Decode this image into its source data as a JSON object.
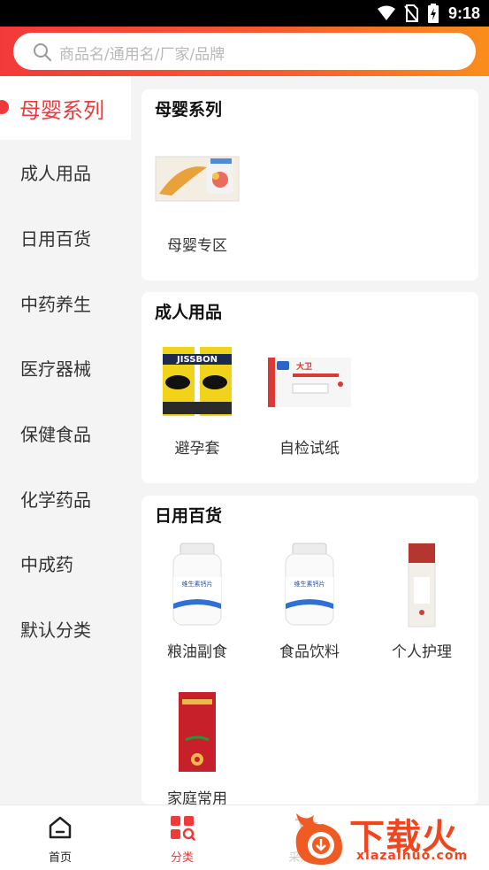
{
  "status_bar": {
    "time": "9:18"
  },
  "search": {
    "placeholder": "商品名/通用名/厂家/品牌"
  },
  "sidebar": {
    "items": [
      {
        "label": "母婴系列",
        "active": true
      },
      {
        "label": "成人用品"
      },
      {
        "label": "日用百货"
      },
      {
        "label": "中药养生"
      },
      {
        "label": "医疗器械"
      },
      {
        "label": "保健食品"
      },
      {
        "label": "化学药品"
      },
      {
        "label": "中成药"
      },
      {
        "label": "默认分类"
      }
    ]
  },
  "sections": [
    {
      "title": "母婴系列",
      "items": [
        {
          "name": "母婴专区"
        }
      ]
    },
    {
      "title": "成人用品",
      "items": [
        {
          "name": "避孕套"
        },
        {
          "name": "自检试纸"
        }
      ]
    },
    {
      "title": "日用百货",
      "items": [
        {
          "name": "粮油副食"
        },
        {
          "name": "食品饮料"
        },
        {
          "name": "个人护理"
        },
        {
          "name": "家庭常用"
        }
      ]
    }
  ],
  "product_image_text": {
    "condom_brand": "JISSBON",
    "test_paper_brand": "大卫",
    "bottle_label": "维生素钙片"
  },
  "tabbar": {
    "tabs": [
      {
        "label": "首页",
        "icon": "home-icon"
      },
      {
        "label": "分类",
        "icon": "category-icon",
        "active": true
      },
      {
        "label": "采购单",
        "icon": "cart-icon"
      }
    ]
  },
  "watermark": {
    "brand": "下载火",
    "domain": "xiazaihuo.com"
  },
  "colors": {
    "accent": "#ef3a39",
    "header_start": "#f23a3a",
    "header_end": "#fa8d1c"
  }
}
